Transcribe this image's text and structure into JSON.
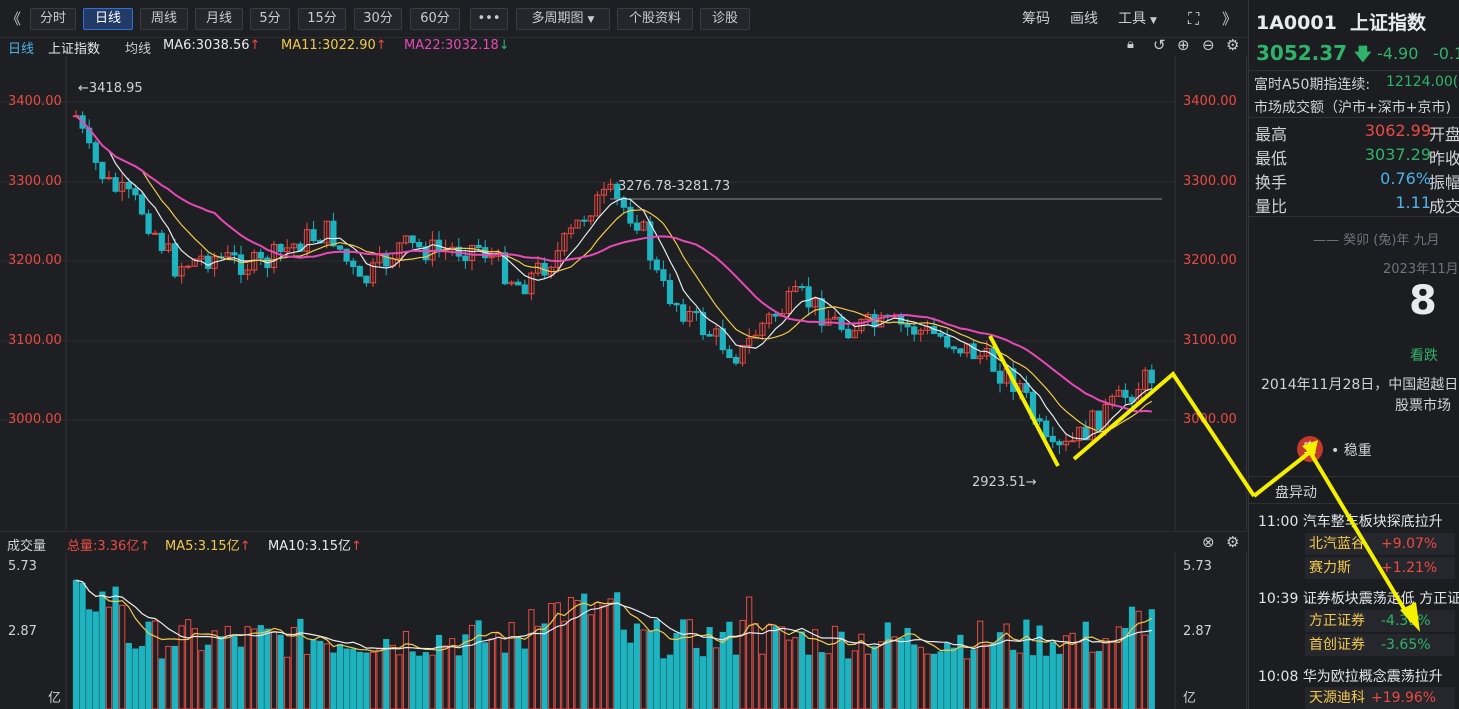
{
  "toolbar": {
    "back": "《",
    "periods": [
      "分时",
      "日线",
      "周线",
      "月线",
      "5分",
      "15分",
      "30分",
      "60分"
    ],
    "active_period": "日线",
    "more": "•••",
    "multi_period": "多周期图",
    "stock_info": "个股资料",
    "diagnose": "诊股",
    "chips": "筹码",
    "draw": "画线",
    "tools": "工具",
    "fullscreen_icon": "expand-icon"
  },
  "ma_bar": {
    "period": "日线",
    "name": "上证指数",
    "avg": "均线",
    "ma6": "MA6:3038.56",
    "ma11": "MA11:3022.90",
    "ma22": "MA22:3032.18",
    "ma6_color": "#e8eaed",
    "ma11_color": "#f2c94c",
    "ma22_color": "#e84ab5"
  },
  "price_axis": {
    "ticks": [
      "3400.00",
      "3300.00",
      "3200.00",
      "3100.00",
      "3000.00"
    ]
  },
  "annotations": {
    "high_label": "←3418.95",
    "range_label": "3276.78-3281.73",
    "low_label": "2923.51→"
  },
  "volume_bar": {
    "title": "成交量",
    "total": "总量:3.36亿",
    "ma5": "MA5:3.15亿",
    "ma10": "MA10:3.15亿",
    "ticks": [
      "5.73",
      "2.87",
      "亿"
    ]
  },
  "quote": {
    "code": "1A0001",
    "name": "上证指数",
    "price": "3052.37",
    "change": "-4.90",
    "change_pct": "-0.1",
    "futures_label": "富时A50期指连续:",
    "futures_value": "12124.00(",
    "turnover_label": "市场成交额（沪市+深市+京市)",
    "stats": [
      {
        "label": "最高",
        "value": "3062.99",
        "tail": "开盘",
        "color": "#ea4a43"
      },
      {
        "label": "最低",
        "value": "3037.29",
        "tail": "昨收",
        "color": "#2fb36a"
      },
      {
        "label": "换手",
        "value": "0.76%",
        "tail": "振幅",
        "color": "#4db2e8"
      },
      {
        "label": "量比",
        "value": "1.11",
        "tail": "成交",
        "color": "#4db2e8"
      }
    ]
  },
  "calendar": {
    "lunar": "—— 癸卯 (兔)年 九月",
    "month": "2023年11月",
    "day": "8",
    "sentiment": "看跌",
    "event_line1": "2014年11月28日，中国超越日",
    "event_line2": "股票市场",
    "yi_char": "宜",
    "yi_text": "• 稳重"
  },
  "alerts": {
    "title": "盘异动",
    "items": [
      {
        "time": "11:00",
        "text": "汽车整车板块探底拉升 ",
        "stocks": [
          {
            "name": "北汽蓝谷",
            "change": "+9.07%",
            "color": "#ea4a43"
          },
          {
            "name": "赛力斯",
            "change": "+1.21%",
            "color": "#ea4a43"
          }
        ]
      },
      {
        "time": "10:39",
        "text": "证券板块震荡走低 方正证",
        "stocks": [
          {
            "name": "方正证券",
            "change": "-4.39%",
            "color": "#2fb36a"
          },
          {
            "name": "首创证券",
            "change": "-3.65%",
            "color": "#2fb36a"
          }
        ]
      },
      {
        "time": "10:08",
        "text": "华为欧拉概念震荡拉升 ",
        "stocks": [
          {
            "name": "天源迪科",
            "change": "+19.96%",
            "color": "#ea4a43"
          }
        ]
      }
    ]
  }
}
